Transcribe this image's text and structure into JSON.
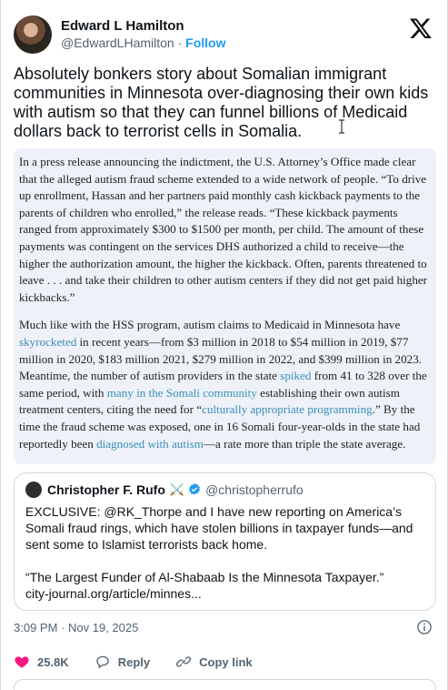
{
  "author": {
    "display_name": "Edward L Hamilton",
    "handle": "@EdwardLHamilton",
    "separator": "·",
    "follow_label": "Follow"
  },
  "tweet": {
    "text": "Absolutely bonkers story about Somalian immigrant communities in Minnesota over-diagnosing their own kids with autism so that they can funnel billions of Medicaid dollars back to terrorist cells in Somalia."
  },
  "quote": {
    "p1": "In a press release announcing the indictment, the U.S. Attorney’s Office made clear that the alleged autism fraud scheme extended to a wide network of people. “To drive up enrollment, Hassan and her partners paid monthly cash kickback payments to the parents of children who enrolled,” the release reads. “These kickback payments ranged from approximately $300 to $1500 per month, per child. The amount of these payments was contingent on the services DHS authorized a child to receive—the higher the authorization amount, the higher the kickback. Often, parents threatened to leave . . . and take their children to other autism centers if they did not get paid higher kickbacks.”",
    "p2_a": "Much like with the HSS program, autism claims to Medicaid in Minnesota have ",
    "p2_link1": "skyrocketed",
    "p2_b": " in recent years—from $3 million in 2018 to $54 million in 2019, $77 million in 2020, $183 million 2021, $279 million in 2022, and $399 million in 2023. Meantime, the number of autism providers in the state ",
    "p2_link2": "spiked",
    "p2_c": " from 41 to 328 over the same period, with ",
    "p2_link3": "many in the Somali community",
    "p2_d": " establishing their own autism treatment centers, citing the need for “",
    "p2_link4": "culturally appropriate programming",
    "p2_e": ".” By the time the fraud scheme was exposed, one in 16 Somali four-year-olds in the state had reportedly been ",
    "p2_link5": "diagnosed with autism",
    "p2_f": "—a rate more than triple the state average."
  },
  "embedded": {
    "display_name": "Christopher F. Rufo",
    "emoji": "⚔️",
    "handle": "@christopherrufo",
    "line1": "EXCLUSIVE: @RK_Thorpe and I have new reporting on America’s Somali fraud rings, which have stolen billions in taxpayer funds—and sent some to Islamist terrorists back home.",
    "line2": "“The Largest Funder of Al-Shabaab Is the Minnesota Taxpayer.”",
    "line3": "city-journal.org/article/minnes..."
  },
  "meta": {
    "time": "3:09 PM",
    "separator": "·",
    "date": "Nov 19, 2025"
  },
  "actions": {
    "likes": "25.8K",
    "reply_label": "Reply",
    "copy_label": "Copy link"
  },
  "colors": {
    "accent": "#1d9bf0",
    "like": "#f91880",
    "quote_bg": "#eef1f8",
    "link": "#3a8fb7"
  },
  "icons": [
    "x-logo-icon",
    "verified-badge-icon",
    "info-icon",
    "heart-icon",
    "reply-icon",
    "link-icon"
  ]
}
